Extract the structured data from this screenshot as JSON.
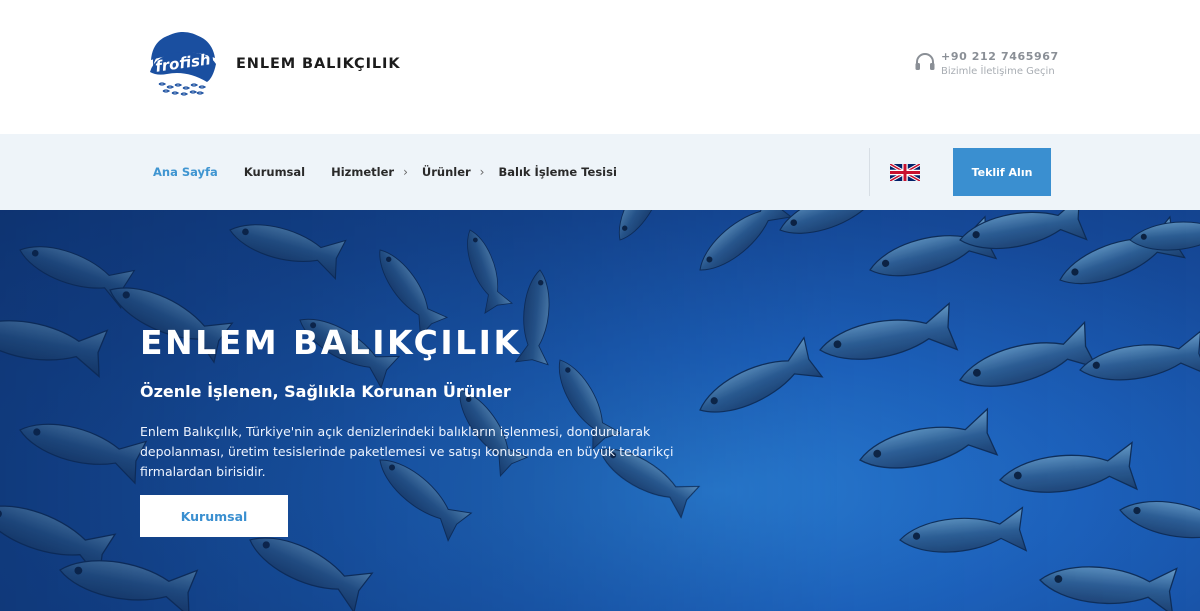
{
  "header": {
    "logo_text": "frofish",
    "brand_name": "ENLEM BALIKÇILIK",
    "phone": "+90 212 7465967",
    "contact_label": "Bizimle İletişime Geçin",
    "icons": {
      "contact": "headset-icon"
    }
  },
  "nav": {
    "items": [
      {
        "label": "Ana Sayfa",
        "active": true,
        "has_submenu": false
      },
      {
        "label": "Kurumsal",
        "active": false,
        "has_submenu": false
      },
      {
        "label": "Hizmetler",
        "active": false,
        "has_submenu": true
      },
      {
        "label": "Ürünler",
        "active": false,
        "has_submenu": true
      },
      {
        "label": "Balık İşleme Tesisi",
        "active": false,
        "has_submenu": false
      }
    ],
    "language_icon": "uk-flag-icon",
    "cta_label": "Teklif Alın"
  },
  "hero": {
    "title": "ENLEM BALIKÇILIK",
    "subtitle": "Özenle İşlenen, Sağlıkla Korunan Ürünler",
    "text": "Enlem Balıkçılık, Türkiye'nin açık denizlerindeki balıkların işlenmesi, dondurularak depolanması, üretim tesislerinde paketlemesi ve satışı konusunda en büyük tedarikçi firmalardan birisidir.",
    "button_label": "Kurumsal"
  },
  "colors": {
    "accent": "#3a8fd0",
    "nav_background": "#eef4f9",
    "logo_blue": "#1a4fa0",
    "hero_blue": "#1d62bd"
  }
}
